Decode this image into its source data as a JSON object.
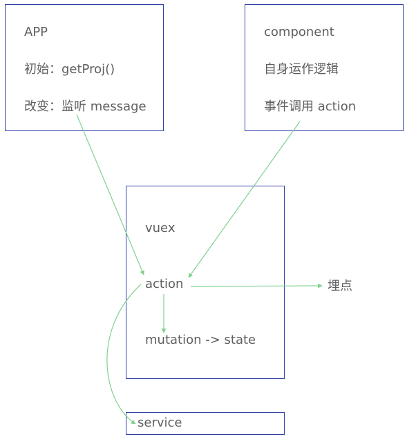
{
  "app_box": {
    "title": "APP",
    "line1": "初始：getProj()",
    "line2": "改变：监听 message"
  },
  "component_box": {
    "title": "component",
    "line1": "自身运作逻辑",
    "line2": "事件调用 action"
  },
  "vuex_box": {
    "title": "vuex",
    "action": "action",
    "mutation": "mutation  ->  state"
  },
  "tracking_label": "埋点",
  "service_box": {
    "label": "service"
  },
  "colors": {
    "border": "#2e3fa8",
    "arrow": "#7fd08e",
    "text": "#5f5f5f"
  }
}
